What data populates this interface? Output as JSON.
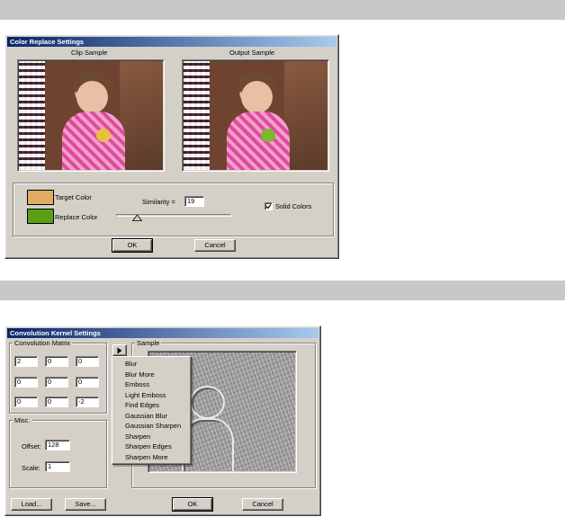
{
  "color_replace": {
    "title": "Color Replace Settings",
    "clip_sample_label": "Clip Sample",
    "output_sample_label": "Output Sample",
    "target_color_label": "Target Color",
    "target_color": "#e0ac64",
    "replace_color_label": "Replace Color",
    "replace_color": "#5aa014",
    "similarity_label": "Similarity =",
    "similarity_value": "19",
    "solid_colors_label": "Solid Colors",
    "solid_colors_checked": true,
    "ok_label": "OK",
    "cancel_label": "Cancel"
  },
  "convolution": {
    "title": "Convolution Kernel Settings",
    "matrix_label": "Convolution Matrix",
    "matrix": [
      [
        "2",
        "0",
        "0"
      ],
      [
        "0",
        "0",
        "0"
      ],
      [
        "0",
        "0",
        "-2"
      ]
    ],
    "misc_label": "Misc.",
    "offset_label": "Offset:",
    "offset_value": "128",
    "scale_label": "Scale:",
    "scale_value": "1",
    "sample_label": "Sample",
    "presets_button_glyph": "▸",
    "menu_items": [
      "Blur",
      "Blur More",
      "Emboss",
      "Light Emboss",
      "Find Edges",
      "Gaussian Blur",
      "Gaussian Sharpen",
      "Sharpen",
      "Sharpen Edges",
      "Sharpen More"
    ],
    "load_label": "Load...",
    "save_label": "Save...",
    "ok_label": "OK",
    "cancel_label": "Cancel"
  },
  "icons": {
    "slider_thumb": "slider-thumb-icon",
    "checkmark": "checkmark-icon",
    "menu_arrow": "arrow-right-icon"
  }
}
